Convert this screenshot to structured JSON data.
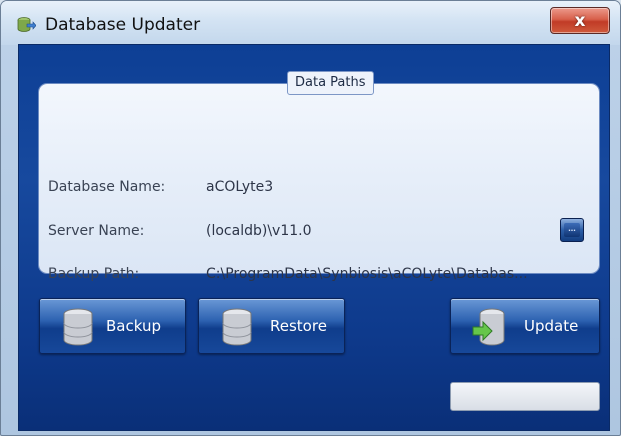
{
  "window": {
    "title": "Database Updater",
    "close_glyph": "x",
    "app_icon": "database-app-icon"
  },
  "panel": {
    "title": "Data Paths",
    "rows": [
      {
        "label": "Database Name:",
        "value": "aCOLyte3"
      },
      {
        "label": "Server Name:",
        "value": "(localdb)\\v11.0"
      },
      {
        "label": "Backup Path:",
        "value": "C:\\ProgramData\\Synbiosis\\aCOLyte\\Databas..."
      }
    ],
    "browse_glyph": "..."
  },
  "buttons": {
    "backup": {
      "label": "Backup",
      "icon": "database-icon"
    },
    "restore": {
      "label": "Restore",
      "icon": "database-icon"
    },
    "update": {
      "label": "Update",
      "icon": "database-arrow-icon"
    }
  },
  "progress": {
    "value": 0
  },
  "colors": {
    "client_bg": "#17499e",
    "panel_bg": "#e6eef9",
    "button_blue": "#2d62b1",
    "close_red": "#c13b26"
  }
}
